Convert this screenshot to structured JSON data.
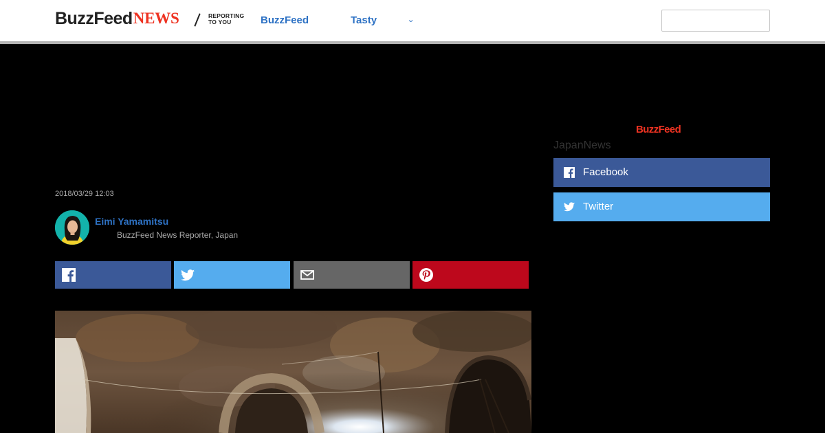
{
  "header": {
    "logo_buzz": "BuzzFeed",
    "logo_news": "NEWS",
    "logo_tag_line1": "REPORTING",
    "logo_tag_line2": "TO YOU",
    "nav": [
      "BuzzFeed",
      "Tasty"
    ],
    "more_chevron": "⌄",
    "search_placeholder": ""
  },
  "article": {
    "timestamp": "2018/03/29 12:03",
    "author_name": "Eimi Yamamitsu",
    "author_role": "BuzzFeed News Reporter, Japan"
  },
  "share": {
    "icons": [
      "facebook-icon",
      "twitter-icon",
      "email-icon",
      "pinterest-icon"
    ],
    "colors": {
      "facebook": "#3b5998",
      "twitter": "#55acee",
      "email": "#666666",
      "pinterest": "#bd081c"
    }
  },
  "sidebar": {
    "logo": "BuzzFeed",
    "label": "JapanNews",
    "buttons": [
      {
        "label": "Facebook",
        "icon": "facebook-icon",
        "color": "#3b5998"
      },
      {
        "label": "Twitter",
        "icon": "twitter-icon",
        "color": "#55acee"
      }
    ]
  },
  "colors": {
    "accent": "#2e72c4",
    "brand_red": "#ee3322"
  }
}
